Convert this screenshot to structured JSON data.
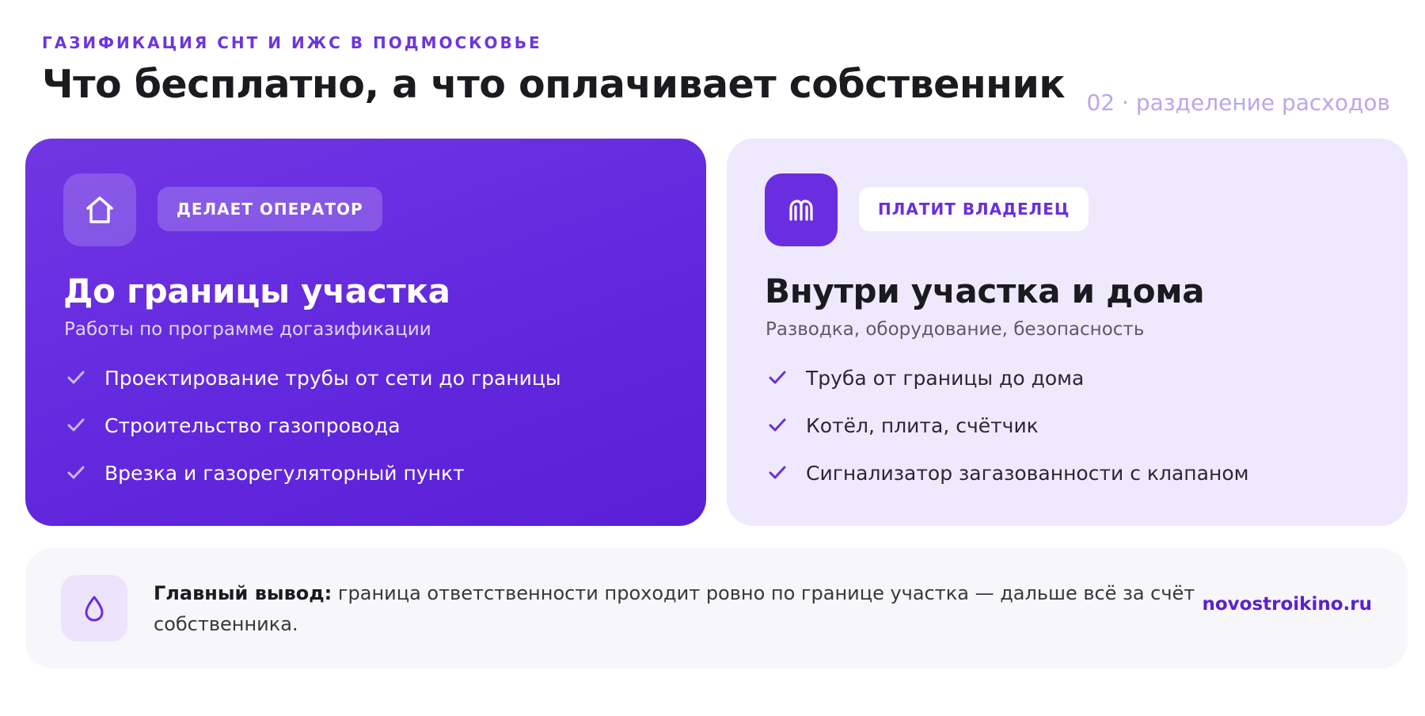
{
  "header": {
    "eyebrow": "ГАЗИФИКАЦИЯ СНТ И ИЖС В ПОДМОСКОВЬЕ",
    "title": "Что бесплатно, а что оплачивает собственник",
    "section_tag": "02 · разделение расходов"
  },
  "cards": {
    "operator": {
      "icon": "home-icon",
      "badge": "ДЕЛАЕТ ОПЕРАТОР",
      "title": "До границы участка",
      "subtitle": "Работы по программе догазификации",
      "items": [
        "Проектирование трубы от сети до границы",
        "Строительство газопровода",
        "Врезка и газорегуляторный пункт"
      ]
    },
    "owner": {
      "icon": "ruble-wallet-icon",
      "badge": "ПЛАТИТ ВЛАДЕЛЕЦ",
      "title": "Внутри участка и дома",
      "subtitle": "Разводка, оборудование, безопасность",
      "items": [
        "Труба от границы до дома",
        "Котёл, плита, счётчик",
        "Сигнализатор загазованности с клапаном"
      ]
    }
  },
  "footer": {
    "icon": "drop-icon",
    "lead": "Главный вывод:",
    "text": "граница ответственности проходит ровно по границе участка — дальше всё за счёт собственника.",
    "site": "novostroikino.ru"
  },
  "colors": {
    "accent": "#6a2ee0",
    "accent_light": "#efe9fd",
    "section_tag": "#b9a7ec",
    "footer_bg": "#f7f6fa"
  }
}
